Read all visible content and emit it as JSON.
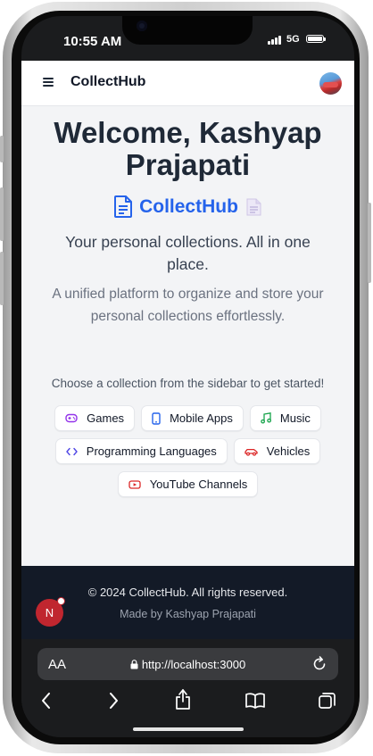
{
  "status_bar": {
    "time": "10:55 AM",
    "network": "5G"
  },
  "header": {
    "brand": "CollectHub"
  },
  "main": {
    "welcome_line1": "Welcome, Kashyap",
    "welcome_line2": "Prajapati",
    "brand": "CollectHub",
    "tagline": "Your personal collections. All in one place.",
    "description": "A unified platform to organize and store your personal collections effortlessly.",
    "choose_text": "Choose a collection from the sidebar to get started!",
    "collections": [
      {
        "label": "Games",
        "icon": "gamepad-icon",
        "color": "#9333ea"
      },
      {
        "label": "Mobile Apps",
        "icon": "smartphone-icon",
        "color": "#2563eb"
      },
      {
        "label": "Music",
        "icon": "music-note-icon",
        "color": "#16a34a"
      },
      {
        "label": "Programming Languages",
        "icon": "code-icon",
        "color": "#4f46e5"
      },
      {
        "label": "Vehicles",
        "icon": "car-icon",
        "color": "#dc2626"
      },
      {
        "label": "YouTube Channels",
        "icon": "youtube-icon",
        "color": "#dc2626"
      }
    ]
  },
  "footer": {
    "copyright": "© 2024 CollectHub. All rights reserved.",
    "made_by": "Made by Kashyap Prajapati",
    "badge_letter": "N"
  },
  "browser": {
    "text_size_label": "AA",
    "url": "http://localhost:3000"
  },
  "colors": {
    "accent": "#2563eb",
    "footer_bg": "#131a27",
    "page_bg": "#f3f4f6"
  }
}
